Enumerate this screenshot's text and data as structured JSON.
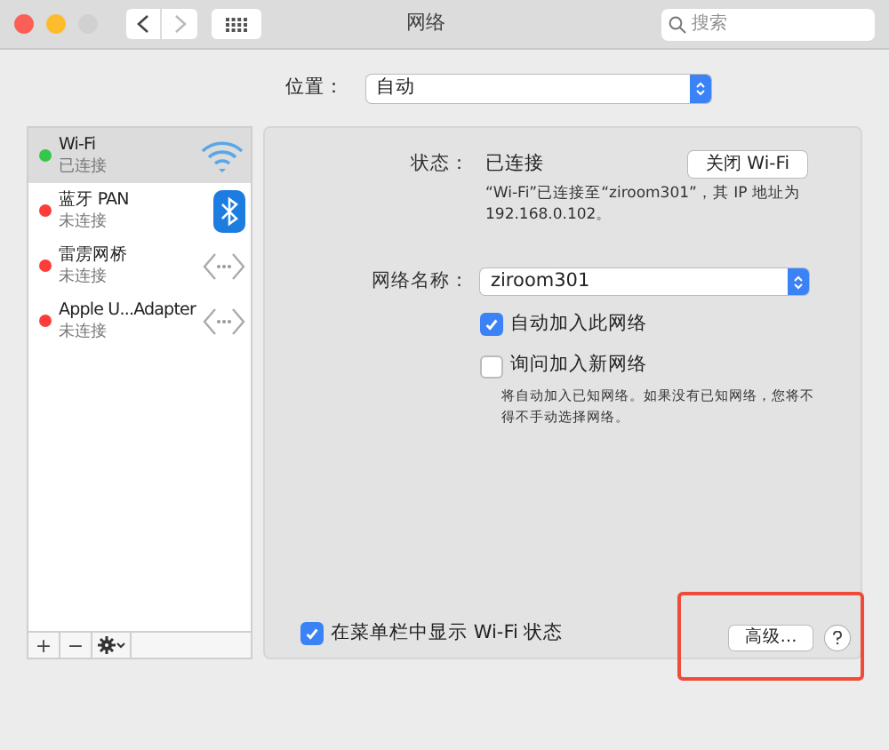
{
  "window": {
    "title": "网络",
    "search_placeholder": "搜索"
  },
  "location": {
    "label": "位置：",
    "value": "自动"
  },
  "services": [
    {
      "name": "Wi-Fi",
      "status": "已连接",
      "color": "#34c749",
      "selected": true,
      "kind": "wifi"
    },
    {
      "name": "蓝牙 PAN",
      "status": "未连接",
      "color": "#fc3d39",
      "selected": false,
      "kind": "bluetooth"
    },
    {
      "name": "雷雳网桥",
      "status": "未连接",
      "color": "#fc3d39",
      "selected": false,
      "kind": "bridge"
    },
    {
      "name": "Apple U...Adapter",
      "status": "未连接",
      "color": "#fc3d39",
      "selected": false,
      "kind": "bridge"
    }
  ],
  "list_buttons": [
    {
      "label": "+"
    },
    {
      "label": "−"
    }
  ],
  "detail": {
    "status_label": "状态：",
    "status_value": "已连接",
    "toggle_button": "关闭 Wi-Fi",
    "status_note": "“Wi-Fi”已连接至“ziroom301”，其 IP 地址为 192.168.0.102。",
    "network_label": "网络名称：",
    "network_value": "ziroom301",
    "options": [
      {
        "label": "自动加入此网络",
        "checked": true
      },
      {
        "label": "询问加入新网络",
        "checked": false
      }
    ],
    "options_note": "将自动加入已知网络。如果没有已知网络，您将不得不手动选择网络。",
    "menu_bar_option": {
      "label": "在菜单栏中显示 Wi-Fi 状态",
      "checked": true
    },
    "advanced_button": "高级…"
  }
}
